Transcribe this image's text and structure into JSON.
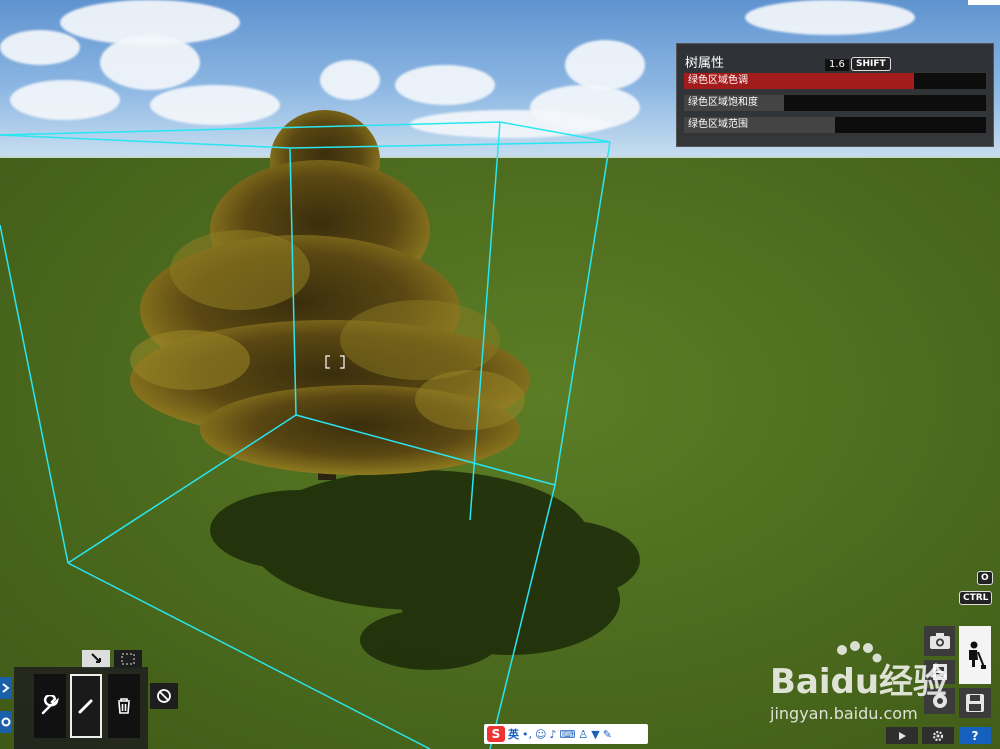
{
  "panel": {
    "title": "树属性",
    "value": "1.6",
    "modifier_key": "SHIFT",
    "sliders": [
      {
        "label": "绿色区域色调",
        "level": 0.76,
        "color": "#a31c1c"
      },
      {
        "label": "绿色区域饱和度",
        "level": 0.33,
        "color": "#444444"
      },
      {
        "label": "绿色区域范围",
        "level": 0.5,
        "color": "#444444"
      }
    ]
  },
  "hints": {
    "o_key": "O",
    "ctrl_key": "CTRL"
  },
  "ime": {
    "lang": "英"
  },
  "watermark": {
    "brand": "Baidu经验",
    "url": "jingyan.baidu.com"
  },
  "colors": {
    "selection_box": "#29e6f0",
    "accent_red": "#a31c1c",
    "help_blue": "#1560bd"
  }
}
